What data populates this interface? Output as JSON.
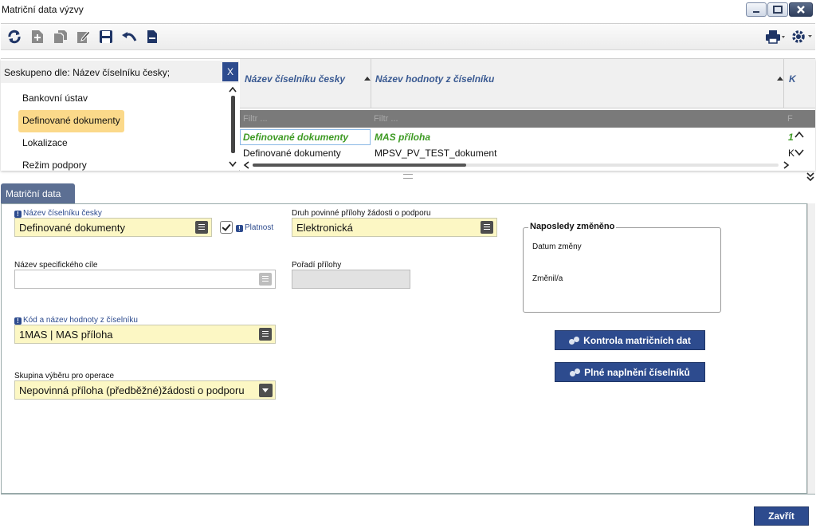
{
  "window": {
    "title": "Matriční data výzvy"
  },
  "toolbar": {
    "icons": [
      "refresh-icon",
      "add-icon",
      "copy-icon",
      "edit-icon",
      "save-icon",
      "undo-icon",
      "delete-icon",
      "print-icon",
      "settings-icon"
    ]
  },
  "grouping": {
    "label": "Seskupeno dle: Název číselníku česky;",
    "remove_label": "X",
    "items": [
      "Bankovní ústav",
      "Definované dokumenty",
      "Lokalizace",
      "Režim podpory"
    ],
    "selected_index": 1
  },
  "grid": {
    "columns": [
      "Název číselníku česky",
      "Název hodnoty z číselníku",
      "K"
    ],
    "filter_placeholders": [
      "Filtr ...",
      "Filtr ...",
      "F"
    ],
    "rows": [
      [
        "Definované dokumenty",
        "MAS příloha",
        "1"
      ],
      [
        "Definované dokumenty",
        "MPSV_PV_TEST_dokument",
        "K"
      ]
    ]
  },
  "tab": {
    "label": "Matriční data"
  },
  "form": {
    "nazev_ciselniku": {
      "label": "Název číselníku česky",
      "value": "Definované dokumenty"
    },
    "platnost": {
      "label": "Platnost",
      "checked": true
    },
    "druh_prilohy": {
      "label": "Druh povinné přílohy žádosti o podporu",
      "value": "Elektronická"
    },
    "nazev_cile": {
      "label": "Název specifického cíle",
      "value": ""
    },
    "poradi": {
      "label": "Pořadí přílohy",
      "value": ""
    },
    "kod_hodnoty": {
      "label": "Kód a název hodnoty z číselníku",
      "value": "1MAS | MAS příloha"
    },
    "skupina": {
      "label": "Skupina výběru pro operace",
      "value": "Nepovinná příloha (předběžné)žádosti o podporu"
    },
    "last_changed": {
      "legend": "Naposledy změněno",
      "date_label": "Datum změny",
      "user_label": "Změnil/a"
    }
  },
  "buttons": {
    "kontrola": "Kontrola matričních dat",
    "naplneni": "Plné naplnění číselníků",
    "zavrit": "Zavřít"
  },
  "colors": {
    "accent": "#2d4b8e",
    "selected_row": "#3d9a23",
    "field_bg": "#fcf7c4",
    "group_selected": "#fbd98a"
  }
}
